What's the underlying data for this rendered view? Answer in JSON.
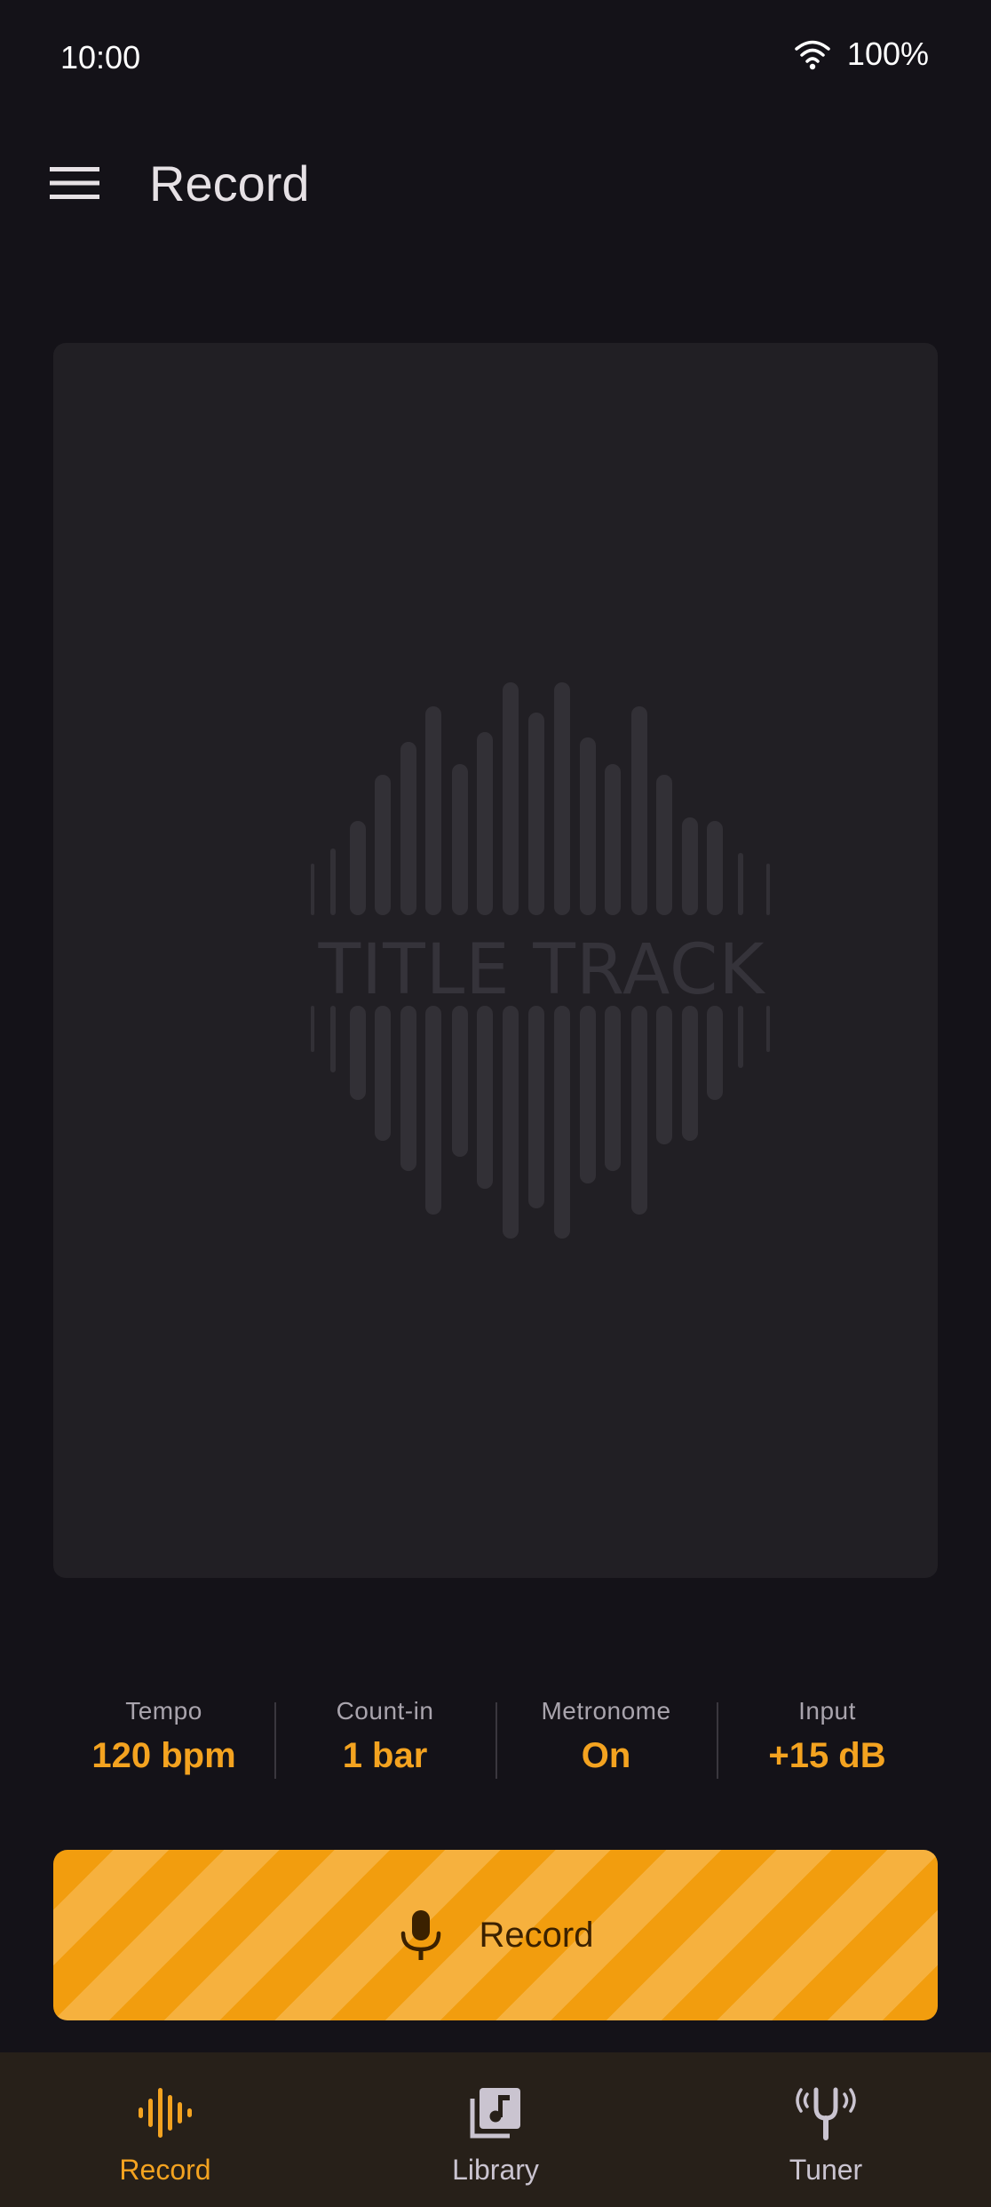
{
  "status_bar": {
    "time": "10:00",
    "battery": "100%",
    "icons": [
      "wifi-icon"
    ]
  },
  "app_bar": {
    "menu_icon": "hamburger-menu-icon",
    "title": "Record"
  },
  "cover": {
    "title": "TITLE TRACK"
  },
  "settings": [
    {
      "label": "Tempo",
      "value": "120 bpm"
    },
    {
      "label": "Count-in",
      "value": "1 bar"
    },
    {
      "label": "Metronome",
      "value": "On"
    },
    {
      "label": "Input",
      "value": "+15 dB"
    }
  ],
  "record_button": {
    "label": "Record",
    "icon": "microphone-icon"
  },
  "bottom_nav": {
    "items": [
      {
        "label": "Record",
        "icon": "waveform-icon",
        "active": true
      },
      {
        "label": "Library",
        "icon": "music-library-icon",
        "active": false
      },
      {
        "label": "Tuner",
        "icon": "tuning-fork-icon",
        "active": false
      }
    ]
  },
  "colors": {
    "background": "#141218",
    "card": "#211f24",
    "accent": "#f4a320",
    "nav_background": "#272019",
    "record_stripe_dark": "#f29d0e",
    "record_stripe_light": "#f6b13e"
  }
}
